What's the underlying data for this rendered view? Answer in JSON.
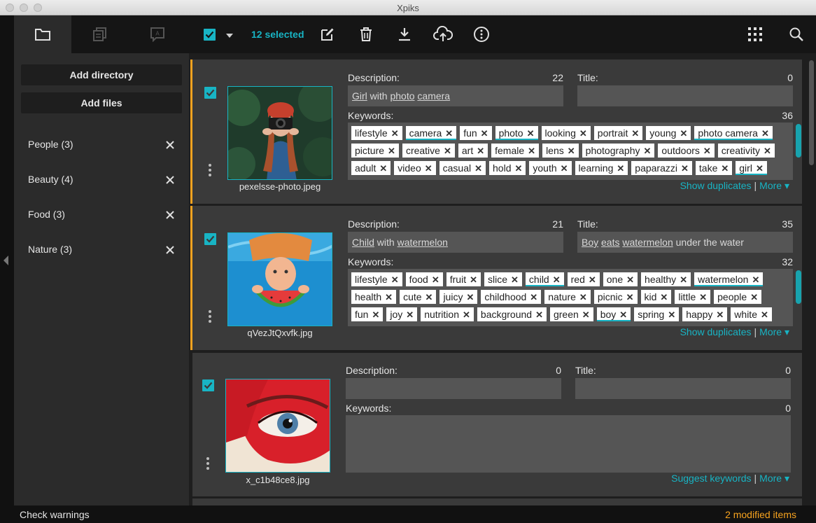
{
  "window": {
    "title": "Xpiks"
  },
  "toolbar": {
    "selected_label": "12 selected",
    "icons": [
      "edit-icon",
      "trash-icon",
      "download-icon",
      "upload-cloud-icon",
      "info-icon",
      "grid-icon",
      "search-icon"
    ]
  },
  "sidebar": {
    "tabs": [
      "folder-icon",
      "files-icon",
      "text-icon"
    ],
    "add_directory": "Add directory",
    "add_files": "Add files",
    "directories": [
      {
        "label": "People (3)"
      },
      {
        "label": "Beauty (4)"
      },
      {
        "label": "Food (3)"
      },
      {
        "label": "Nature (3)"
      }
    ]
  },
  "artworks": [
    {
      "filename": "pexelsse-photo.jpeg",
      "modified": true,
      "description_label": "Description:",
      "description_count": "22",
      "description_html": "<u>Girl</u> with <u>photo</u> <u>camera</u>",
      "title_label": "Title:",
      "title_count": "0",
      "title_html": "",
      "keywords_label": "Keywords:",
      "keywords_count": "36",
      "keyword_rows": [
        [
          [
            "lifestyle",
            0
          ],
          [
            "camera",
            1
          ],
          [
            "fun",
            0
          ],
          [
            "photo",
            1
          ],
          [
            "looking",
            0
          ],
          [
            "portrait",
            0
          ],
          [
            "young",
            0
          ],
          [
            "photo camera",
            1
          ]
        ],
        [
          [
            "picture",
            0
          ],
          [
            "creative",
            0
          ],
          [
            "art",
            0
          ],
          [
            "female",
            0
          ],
          [
            "lens",
            0
          ],
          [
            "photography",
            0
          ],
          [
            "outdoors",
            0
          ],
          [
            "creativity",
            0
          ]
        ],
        [
          [
            "adult",
            0
          ],
          [
            "video",
            0
          ],
          [
            "casual",
            0
          ],
          [
            "hold",
            0
          ],
          [
            "youth",
            0
          ],
          [
            "learning",
            0
          ],
          [
            "paparazzi",
            0
          ],
          [
            "take",
            0
          ],
          [
            "girl",
            1
          ]
        ]
      ],
      "link_main": "Show duplicates",
      "link_more": "More",
      "has_scroll": true
    },
    {
      "filename": "qVezJtQxvfk.jpg",
      "modified": true,
      "description_label": "Description:",
      "description_count": "21",
      "description_html": "<u>Child</u> with <u>watermelon</u>",
      "title_label": "Title:",
      "title_count": "35",
      "title_html": "<u>Boy</u> <u>eats</u> <u>watermelon</u> under the water",
      "keywords_label": "Keywords:",
      "keywords_count": "32",
      "keyword_rows": [
        [
          [
            "lifestyle",
            0
          ],
          [
            "food",
            0
          ],
          [
            "fruit",
            0
          ],
          [
            "slice",
            0
          ],
          [
            "child",
            1
          ],
          [
            "red",
            0
          ],
          [
            "one",
            0
          ],
          [
            "healthy",
            0
          ],
          [
            "watermelon",
            1
          ]
        ],
        [
          [
            "health",
            0
          ],
          [
            "cute",
            0
          ],
          [
            "juicy",
            0
          ],
          [
            "childhood",
            0
          ],
          [
            "nature",
            0
          ],
          [
            "picnic",
            0
          ],
          [
            "kid",
            0
          ],
          [
            "little",
            0
          ],
          [
            "people",
            0
          ]
        ],
        [
          [
            "fun",
            0
          ],
          [
            "joy",
            0
          ],
          [
            "nutrition",
            0
          ],
          [
            "background",
            0
          ],
          [
            "green",
            0
          ],
          [
            "boy",
            1
          ],
          [
            "spring",
            0
          ],
          [
            "happy",
            0
          ],
          [
            "white",
            0
          ]
        ]
      ],
      "link_main": "Show duplicates",
      "link_more": "More",
      "has_scroll": true
    },
    {
      "filename": "x_c1b48ce8.jpg",
      "modified": false,
      "description_label": "Description:",
      "description_count": "0",
      "description_html": "",
      "title_label": "Title:",
      "title_count": "0",
      "title_html": "",
      "keywords_label": "Keywords:",
      "keywords_count": "0",
      "keyword_rows": [],
      "link_main": "Suggest keywords",
      "link_more": "More",
      "has_scroll": false
    }
  ],
  "status": {
    "check_warnings": "Check warnings",
    "modified_items": "2 modified items"
  },
  "colors": {
    "accent": "#18b4c4",
    "modified": "#f7a31f"
  }
}
